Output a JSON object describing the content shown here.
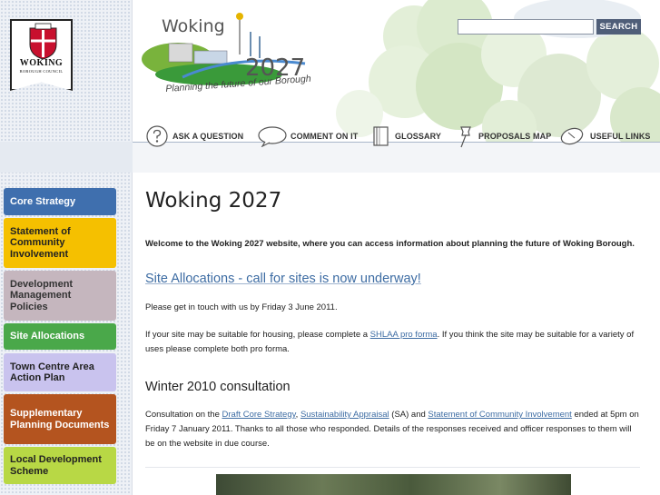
{
  "council": {
    "name": "WOKING",
    "subtitle": "BOROUGH COUNCIL"
  },
  "logo": {
    "wordmark": "Woking",
    "year": "2027",
    "tagline": "Planning the future of our Borough"
  },
  "search": {
    "placeholder": "",
    "button_label": "SEARCH"
  },
  "topnav": [
    {
      "label": "ASK A QUESTION",
      "icon": "question-mark-icon"
    },
    {
      "label": "COMMENT ON IT",
      "icon": "speech-bubble-icon"
    },
    {
      "label": "GLOSSARY",
      "icon": "book-icon"
    },
    {
      "label": "PROPOSALS MAP",
      "icon": "map-pin-icon"
    },
    {
      "label": "USEFUL LINKS",
      "icon": "computer-mouse-icon"
    }
  ],
  "sidebar": [
    {
      "label": "Core Strategy",
      "color": "#3f6fae",
      "text_color": "#ffffff"
    },
    {
      "label": "Statement of Community Involvement",
      "color": "#f5c000",
      "text_color": "#222222"
    },
    {
      "label": "Development Management Policies",
      "color": "#c5b6be",
      "text_color": "#333333"
    },
    {
      "label": "Site Allocations",
      "color": "#4aa84a",
      "text_color": "#ffffff"
    },
    {
      "label": "Town Centre Area Action Plan",
      "color": "#c9c3ee",
      "text_color": "#222222"
    },
    {
      "label": "Supplementary Planning Documents",
      "color": "#b4541f",
      "text_color": "#ffffff"
    },
    {
      "label": "Local Development Scheme",
      "color": "#b8d845",
      "text_color": "#222222"
    }
  ],
  "main": {
    "title": "Woking 2027",
    "welcome": "Welcome to the Woking 2027 website, where you can access information about planning the future of Woking Borough.",
    "headline": "Site Allocations - call for sites is now underway!",
    "contact": "Please get in touch with us by Friday 3 June 2011.",
    "shlaa_pre": "If your site may be suitable for housing, please complete a ",
    "shlaa_link": "SHLAA pro forma",
    "shlaa_post": ". If you think the site may be suitable for a variety of uses please complete both pro forma.",
    "winter_title": "Winter 2010 consultation",
    "consult_pre": "Consultation on the ",
    "consult_link1": "Draft Core Strategy",
    "consult_sep1": ", ",
    "consult_link2": "Sustainability Appraisal",
    "consult_mid": " (SA) and ",
    "consult_link3": "Statement of Community Involvement",
    "consult_post": " ended at 5pm on Friday 7 January 2011. Thanks to all those who responded. Details of the responses received and officer responses to them will be on the website in due course."
  }
}
